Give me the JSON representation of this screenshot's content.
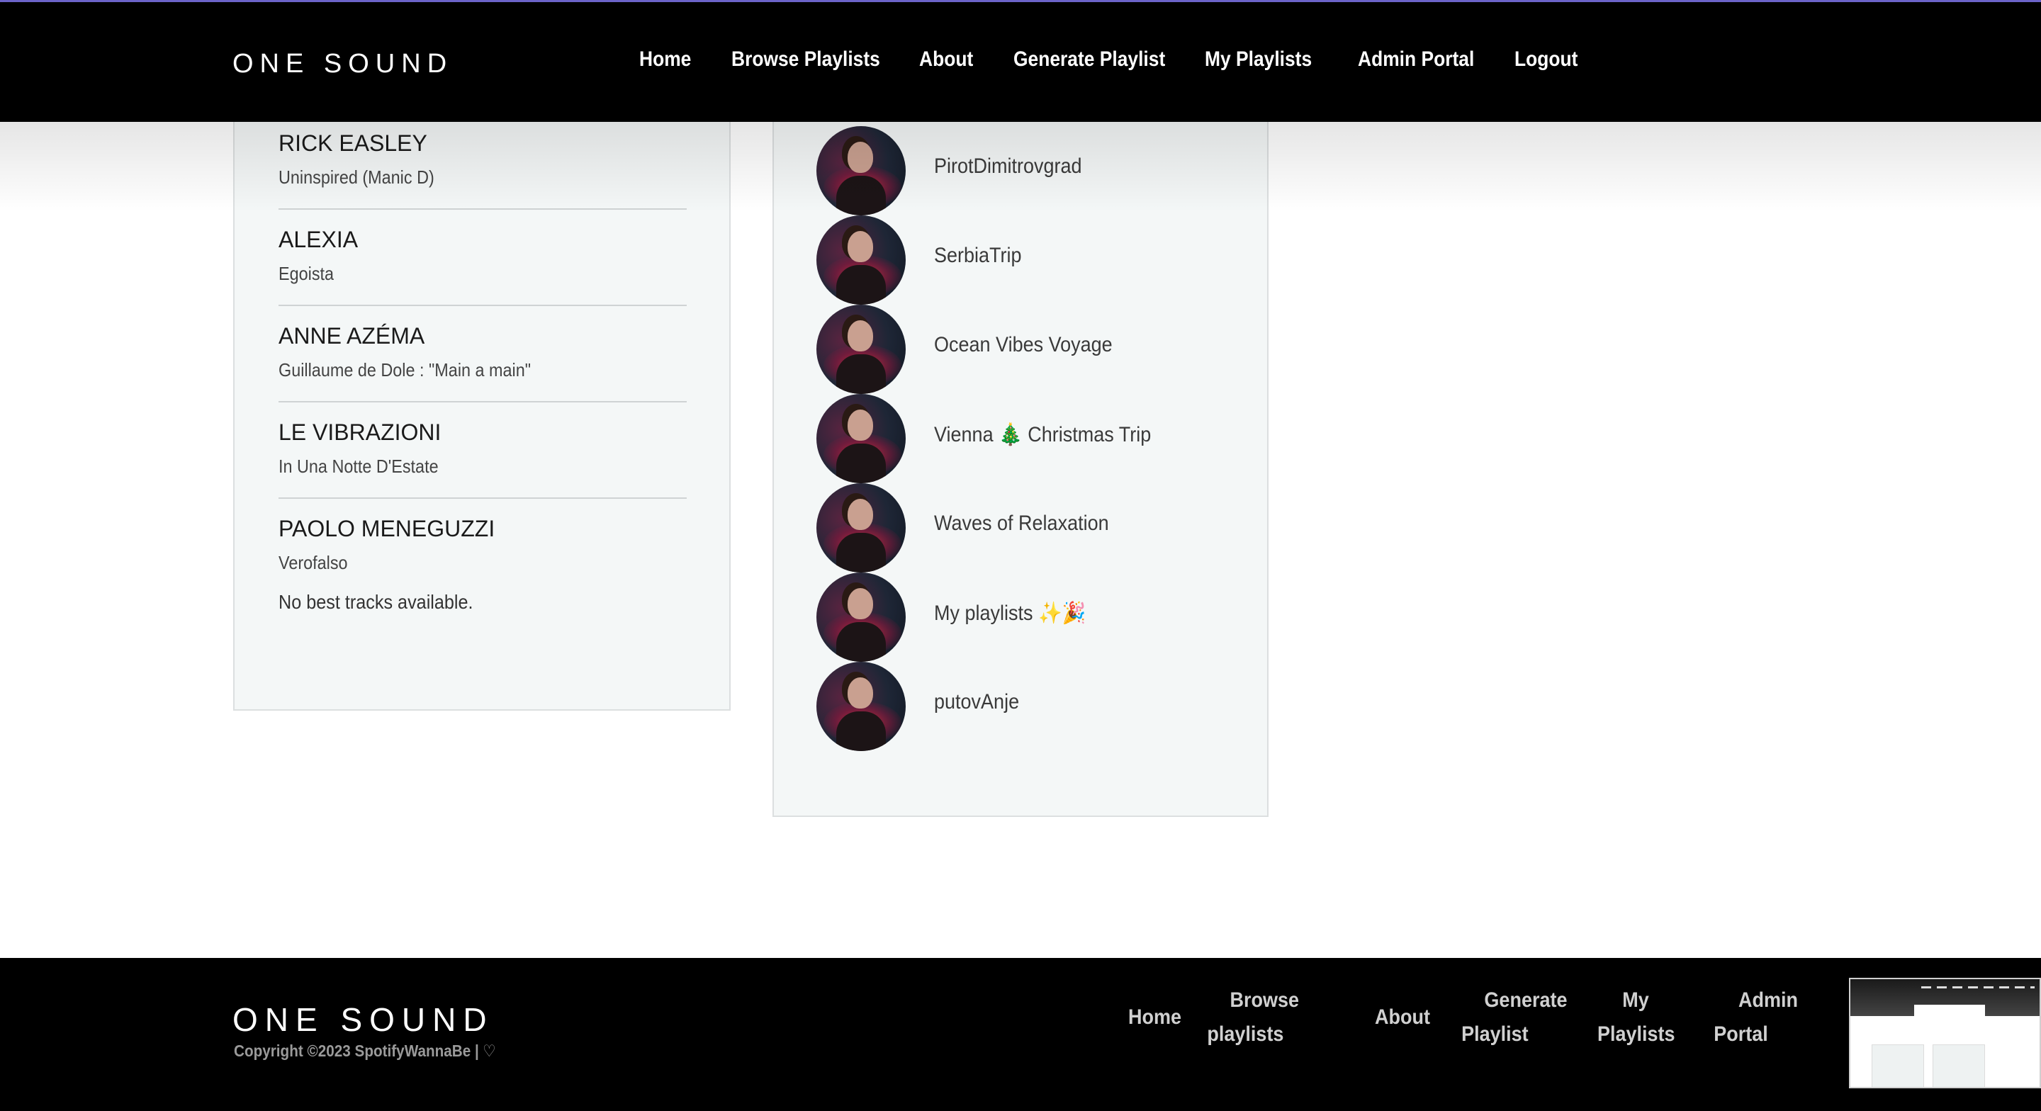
{
  "brand": "ONE SOUND",
  "nav": [
    {
      "label": "Home"
    },
    {
      "label": "Browse Playlists"
    },
    {
      "label": "About"
    },
    {
      "label": "Generate Playlist"
    },
    {
      "label": "My Playlists"
    },
    {
      "label": "Admin Portal"
    },
    {
      "label": "Logout"
    }
  ],
  "best_tracks": {
    "items": [
      {
        "artist": "RICK EASLEY",
        "title": "Uninspired (Manic D)"
      },
      {
        "artist": "ALEXIA",
        "title": "Egoista"
      },
      {
        "artist": "ANNE AZÉMA",
        "title": "Guillaume de Dole : \"Main a main\""
      },
      {
        "artist": "LE VIBRAZIONI",
        "title": "In Una Notte D'Estate"
      },
      {
        "artist": "PAOLO MENEGUZZI",
        "title": "Verofalso"
      }
    ],
    "empty_message": "No best tracks available."
  },
  "playlists": [
    {
      "name": "PirotDimitrovgrad"
    },
    {
      "name": "SerbiaTrip"
    },
    {
      "name": "Ocean Vibes Voyage"
    },
    {
      "name": "Vienna 🎄 Christmas Trip"
    },
    {
      "name": "Waves of Relaxation"
    },
    {
      "name": "My playlists ✨🎉"
    },
    {
      "name": "putovAnje"
    }
  ],
  "footer": {
    "brand": "ONE SOUND",
    "copyright": "Copyright ©2023 SpotifyWannaBe |",
    "heart_icon": "heart-icon",
    "links": [
      {
        "line1": "Home",
        "line2": ""
      },
      {
        "line1": "Browse",
        "line2": "playlists"
      },
      {
        "line1": "About",
        "line2": ""
      },
      {
        "line1": "Generate",
        "line2": "Playlist"
      },
      {
        "line1": "My",
        "line2": "Playlists"
      },
      {
        "line1": "Admin",
        "line2": "Portal"
      }
    ]
  },
  "colors": {
    "nav_bg": "#000000",
    "nav_accent_line": "#6b63c9",
    "card_bg": "#f4f7f7",
    "page_bg": "#ffffff"
  }
}
